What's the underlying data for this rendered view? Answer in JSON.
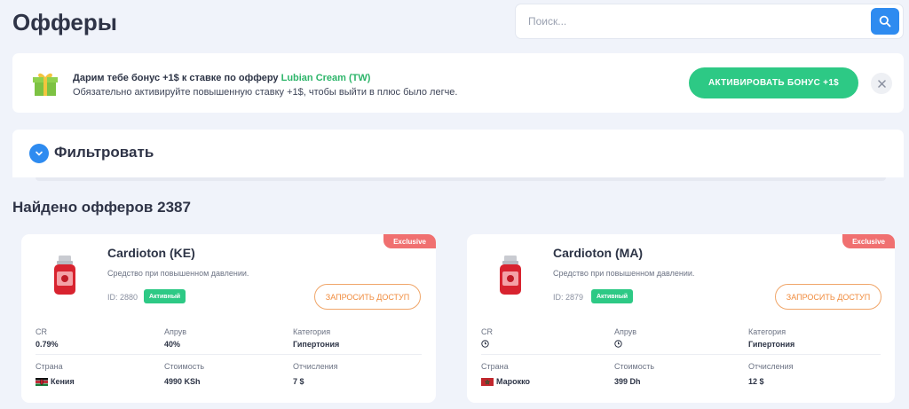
{
  "page": {
    "title": "Офферы"
  },
  "search": {
    "placeholder": "Поиск..."
  },
  "bonus": {
    "line1_prefix": "Дарим тебе бонус +1$ к ставке по офферу ",
    "offer_name": "Lubian Cream (TW)",
    "line2": "Обязательно активируйте повышенную ставку +1$, чтобы выйти в плюс было легче.",
    "button_label": "АКТИВИРОВАТЬ БОНУС +1$"
  },
  "filter": {
    "label": "Фильтровать"
  },
  "found": {
    "text": "Найдено офферов 2387"
  },
  "labels": {
    "cr": "CR",
    "approve": "Апрув",
    "category": "Категория",
    "country": "Страна",
    "cost": "Стоимость",
    "payout": "Отчисления",
    "request_access": "ЗАПРОСИТЬ ДОСТУП",
    "exclusive": "Exclusive"
  },
  "offers": [
    {
      "title": "Cardioton (KE)",
      "description": "Средство при повышенном давлении.",
      "id_text": "ID: 2880",
      "status": "Активный",
      "cr": "0.79%",
      "approve": "40%",
      "category": "Гипертония",
      "country": "Кения",
      "cost": "4990 KSh",
      "payout": "7 $"
    },
    {
      "title": "Cardioton (MA)",
      "description": "Средство при повышенном давлении.",
      "id_text": "ID: 2879",
      "status": "Активный",
      "cr": "",
      "approve": "",
      "category": "Гипертония",
      "country": "Марокко",
      "cost": "399 Dh",
      "payout": "12 $"
    }
  ],
  "colors": {
    "accent_blue": "#2e8bf0",
    "accent_green": "#2dc985",
    "exclusive_red": "#f07070",
    "request_orange": "#f08b3d"
  }
}
